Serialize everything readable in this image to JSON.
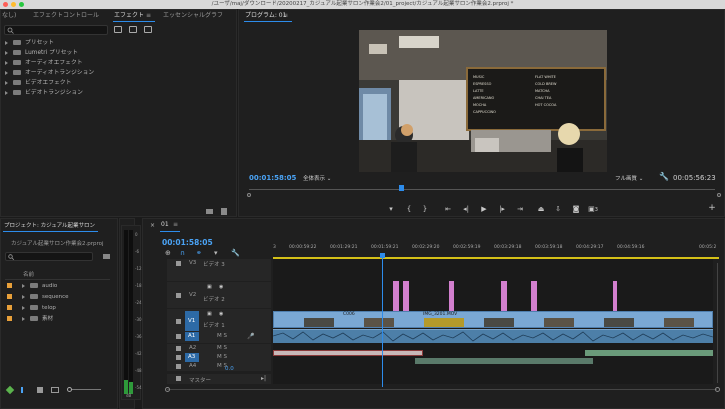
{
  "window": {
    "title": "/ユーザ/maj/ダウンロード/20200217_カジュアル起業サロン作業会2/01_project/カジュアル起業サロン作業会2.prproj *"
  },
  "effects_panel": {
    "tabs": [
      {
        "label": "なし)"
      },
      {
        "label": "エフェクトコントロール"
      },
      {
        "label": "エフェクト"
      },
      {
        "label": "≡"
      },
      {
        "label": "エッセンシャルグラフ"
      }
    ],
    "search_placeholder": "",
    "items": [
      {
        "label": "プリセット"
      },
      {
        "label": "Lumetri プリセット"
      },
      {
        "label": "オーディオエフェクト"
      },
      {
        "label": "オーディオトランジション"
      },
      {
        "label": "ビデオエフェクト"
      },
      {
        "label": "ビデオトランジション"
      }
    ]
  },
  "program_monitor": {
    "tab_label": "プログラム: 01",
    "menu_icon": "≡",
    "timecode_current": "00:01:58:05",
    "zoom": "全体表示",
    "quality": "フル画質",
    "timecode_duration": "00:05:56:23",
    "frame_badge": "3",
    "menu_lines": [
      "MUSIC",
      "ESPRESSO",
      "LATTE",
      "AMERICANO",
      "MOCHA",
      "CAPPUCCINO",
      "FLAT WHITE",
      "COLD BREW",
      "MATCHA",
      "CHAI TEA",
      "HOT COCOA"
    ]
  },
  "project_panel": {
    "tab_label": "プロジェクト: カジュアル起業サロン",
    "file": "カジュアル起業サロン作業会2.prproj",
    "column_name": "名前",
    "bins": [
      {
        "label": "audio"
      },
      {
        "label": "sequence"
      },
      {
        "label": "telop"
      },
      {
        "label": "素材"
      }
    ]
  },
  "meter": {
    "labels": [
      "0",
      "-6",
      "-12",
      "-18",
      "-24",
      "-30",
      "-36",
      "-42",
      "-48",
      "-54"
    ],
    "bottom_label": "dB"
  },
  "timeline": {
    "tab_label": "01",
    "menu_icon": "≡",
    "timecode": "00:01:58:05",
    "ruler": [
      "3",
      "00:00:59:22",
      "00:01:29:21",
      "00:01:59:21",
      "00:02:29:20",
      "00:02:59:19",
      "00:03:29:18",
      "00:03:59:18",
      "00:04:29:17",
      "00:04:59:16",
      "00:05:2"
    ],
    "tracks": [
      {
        "name": "V3",
        "label": "ビデオ 3"
      },
      {
        "name": "V2",
        "label": "ビデオ 2"
      },
      {
        "name": "V1",
        "label": "ビデオ 1"
      },
      {
        "name": "A1",
        "label": "M S"
      },
      {
        "name": "A2",
        "label": "M S"
      },
      {
        "name": "A3",
        "label": "M S"
      },
      {
        "name": "A4",
        "label": "M S"
      }
    ],
    "clip_labels": [
      "C006",
      "IMG_3201.MOV"
    ],
    "master_label": "マスター",
    "master_value": "0.0"
  },
  "colors": {
    "accent": "#2d8ceb",
    "timecode": "#4aa3f5",
    "v1_clip": "#7aa8d4",
    "v2_clip": "#d27fce",
    "audio_clip": "#4b8a6a",
    "bin_label": "#e8a03a"
  }
}
